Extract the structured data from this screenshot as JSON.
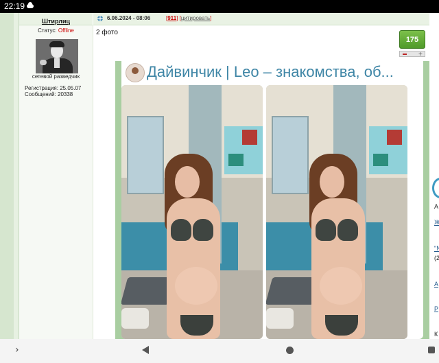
{
  "status_bar": {
    "time": "22:19"
  },
  "post": {
    "username": "Штирлиц",
    "status_label": "Статус:",
    "status_value": "Offline",
    "rank": "сетевой разведчик",
    "registration": "Регистрация: 25.05.07",
    "messages": "Сообщений: 20338",
    "date": "6.06.2024 - 08:06",
    "replies_prefix": "[",
    "replies_count": "911",
    "replies_mid": "] [",
    "quote_label": "цитировать",
    "replies_suffix": "]",
    "text": "2 фото",
    "score": "175",
    "vote_minus": "–",
    "vote_plus": "+"
  },
  "photo": {
    "channel_title": "Дайвинчик | Leo – знакомства, об..."
  },
  "peek_letters": [
    "А",
    "Ж",
    "\"N",
    "(2",
    "А",
    "Р",
    "К"
  ],
  "navbar": {
    "forward": "›"
  },
  "colors": {
    "accent_green": "#5aa832",
    "offline": "#cc0000",
    "channel_blue": "#3f86a6"
  }
}
